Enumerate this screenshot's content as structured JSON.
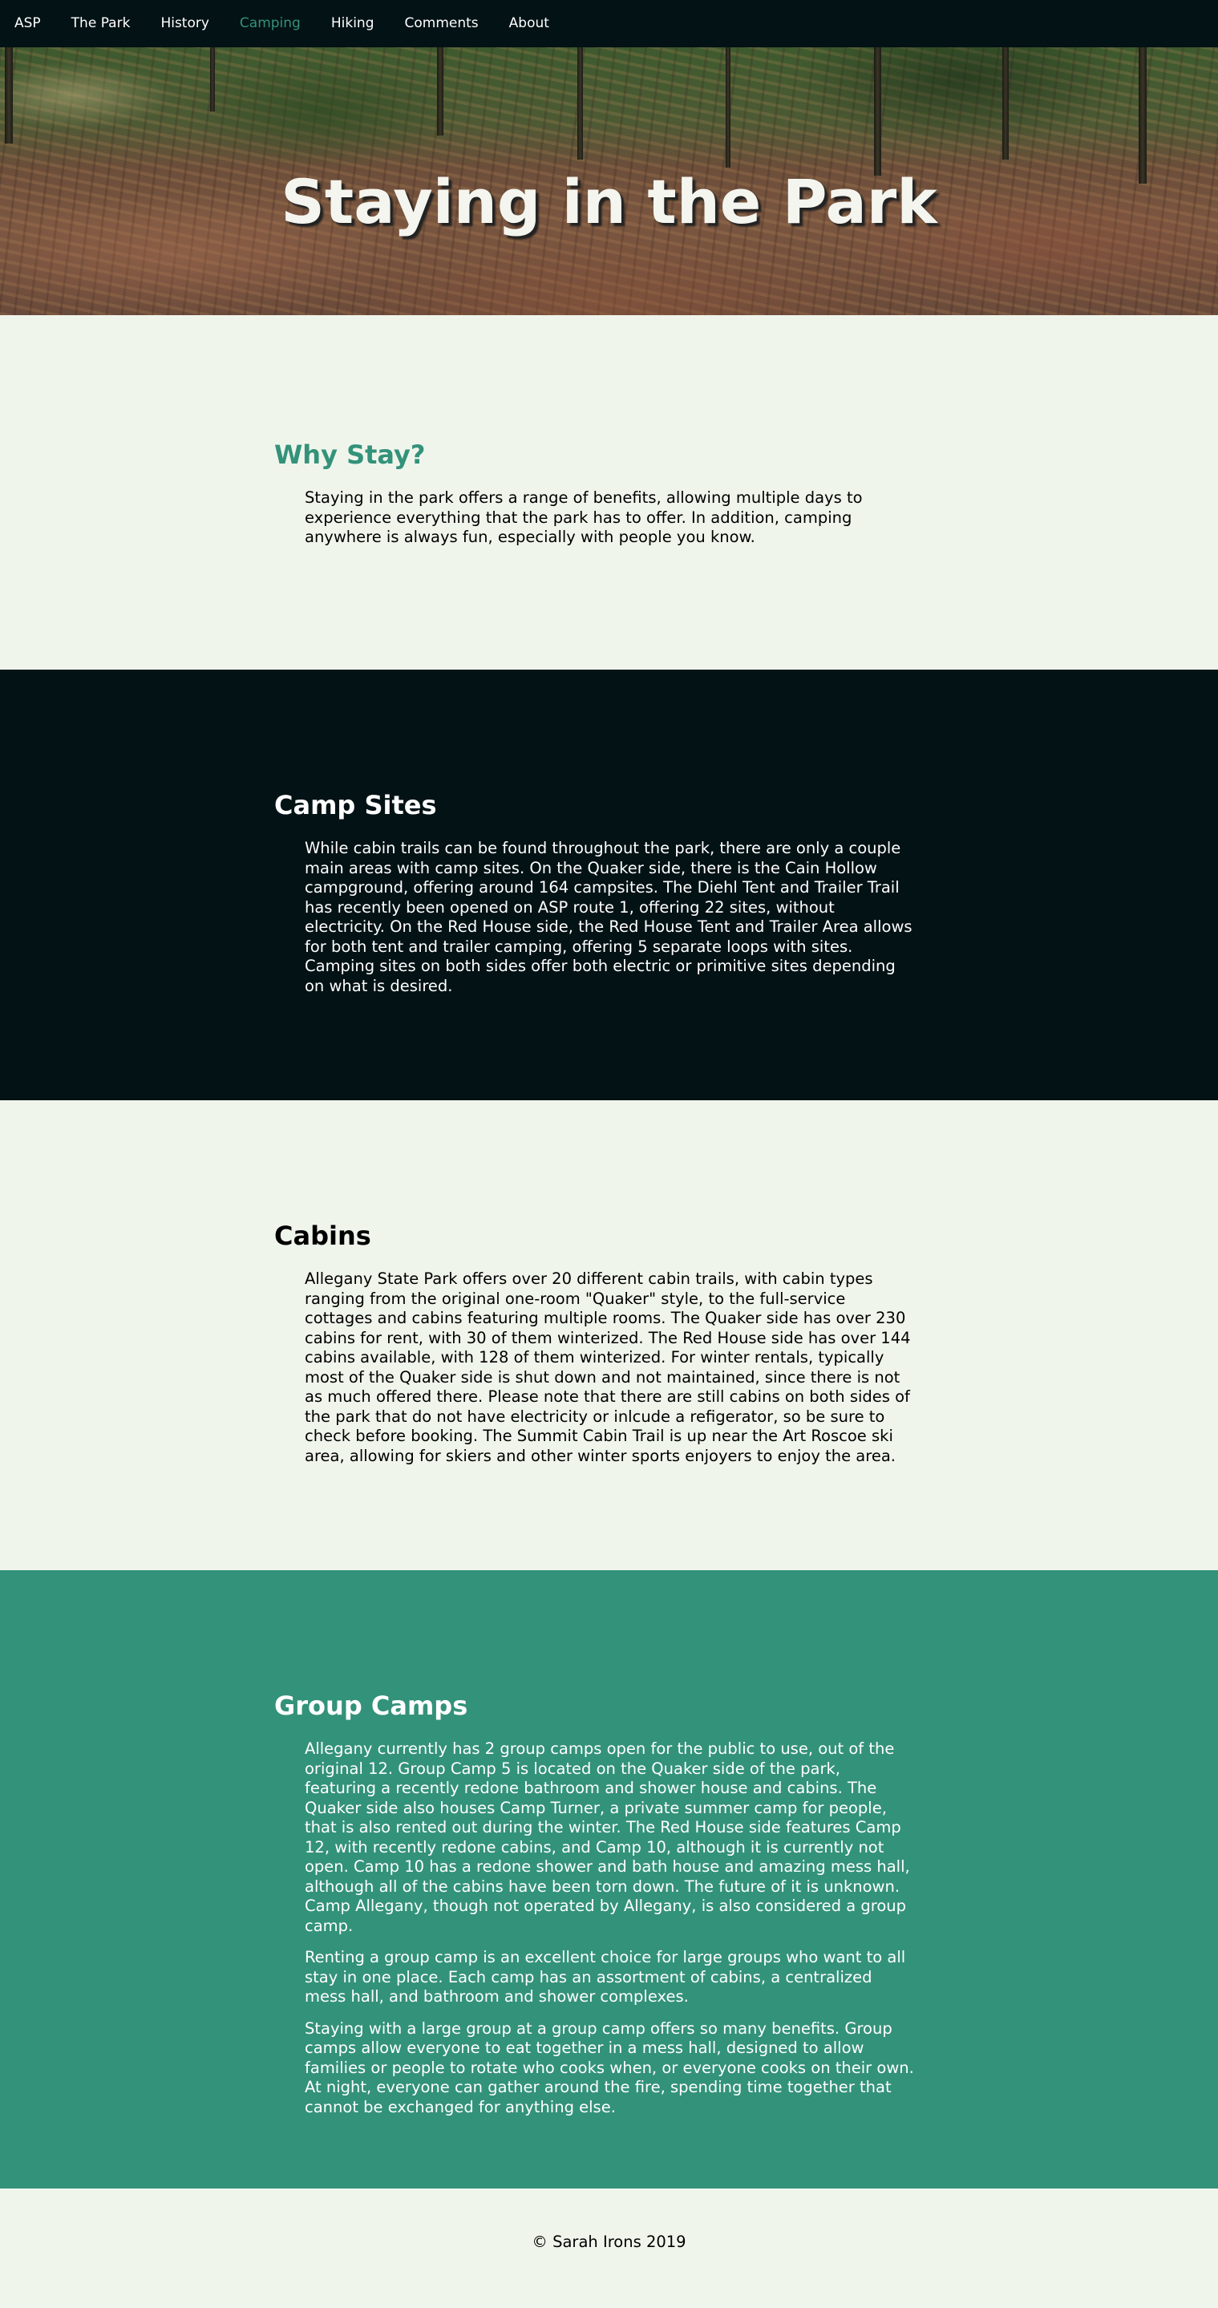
{
  "nav": {
    "items": [
      {
        "label": "ASP",
        "active": false
      },
      {
        "label": "The Park",
        "active": false
      },
      {
        "label": "History",
        "active": false
      },
      {
        "label": "Camping",
        "active": true
      },
      {
        "label": "Hiking",
        "active": false
      },
      {
        "label": "Comments",
        "active": false
      },
      {
        "label": "About",
        "active": false
      }
    ]
  },
  "hero": {
    "title": "Staying in the Park"
  },
  "sections": {
    "why_stay": {
      "heading": "Why Stay?",
      "paragraphs": [
        "Staying in the park offers a range of benefits, allowing multiple days to experience everything that the park has to offer. In addition, camping anywhere is always fun, especially with people you know."
      ]
    },
    "camp_sites": {
      "heading": "Camp Sites",
      "paragraphs": [
        "While cabin trails can be found throughout the park, there are only a couple main areas with camp sites. On the Quaker side, there is the Cain Hollow campground, offering around 164 campsites. The Diehl Tent and Trailer Trail has recently been opened on ASP route 1, offering 22 sites, without electricity. On the Red House side, the Red House Tent and Trailer Area allows for both tent and trailer camping, offering 5 separate loops with sites. Camping sites on both sides offer both electric or primitive sites depending on what is desired."
      ]
    },
    "cabins": {
      "heading": "Cabins",
      "paragraphs": [
        "Allegany State Park offers over 20 different cabin trails, with cabin types ranging from the original one-room \"Quaker\" style, to the full-service cottages and cabins featuring multiple rooms. The Quaker side has over 230 cabins for rent, with 30 of them winterized. The Red House side has over 144 cabins available, with 128 of them winterized. For winter rentals, typically most of the Quaker side is shut down and not maintained, since there is not as much offered there. Please note that there are still cabins on both sides of the park that do not have electricity or inlcude a refigerator, so be sure to check before booking. The Summit Cabin Trail is up near the Art Roscoe ski area, allowing for skiers and other winter sports enjoyers to enjoy the area."
      ]
    },
    "group_camps": {
      "heading": "Group Camps",
      "paragraphs": [
        "Allegany currently has 2 group camps open for the public to use, out of the original 12. Group Camp 5 is located on the Quaker side of the park, featuring a recently redone bathroom and shower house and cabins. The Quaker side also houses Camp Turner, a private summer camp for people, that is also rented out during the winter. The Red House side features Camp 12, with recently redone cabins, and Camp 10, although it is currently not open. Camp 10 has a redone shower and bath house and amazing mess hall, although all of the cabins have been torn down. The future of it is unknown. Camp Allegany, though not operated by Allegany, is also considered a group camp.",
        "Renting a group camp is an excellent choice for large groups who want to all stay in one place. Each camp has an assortment of cabins, a centralized mess hall, and bathroom and shower complexes.",
        "Staying with a large group at a group camp offers so many benefits. Group camps allow everyone to eat together in a mess hall, designed to allow families or people to rotate who cooks when, or everyone cooks on their own. At night, everyone can gather around the fire, spending time together that cannot be exchanged for anything else."
      ]
    }
  },
  "footer": {
    "text": "© Sarah Irons 2019"
  },
  "colors": {
    "nav_bg": "#031215",
    "accent": "#33927a",
    "light_bg": "#f0f5ec",
    "dark_bg": "#031215",
    "green_bg": "#33927a"
  }
}
